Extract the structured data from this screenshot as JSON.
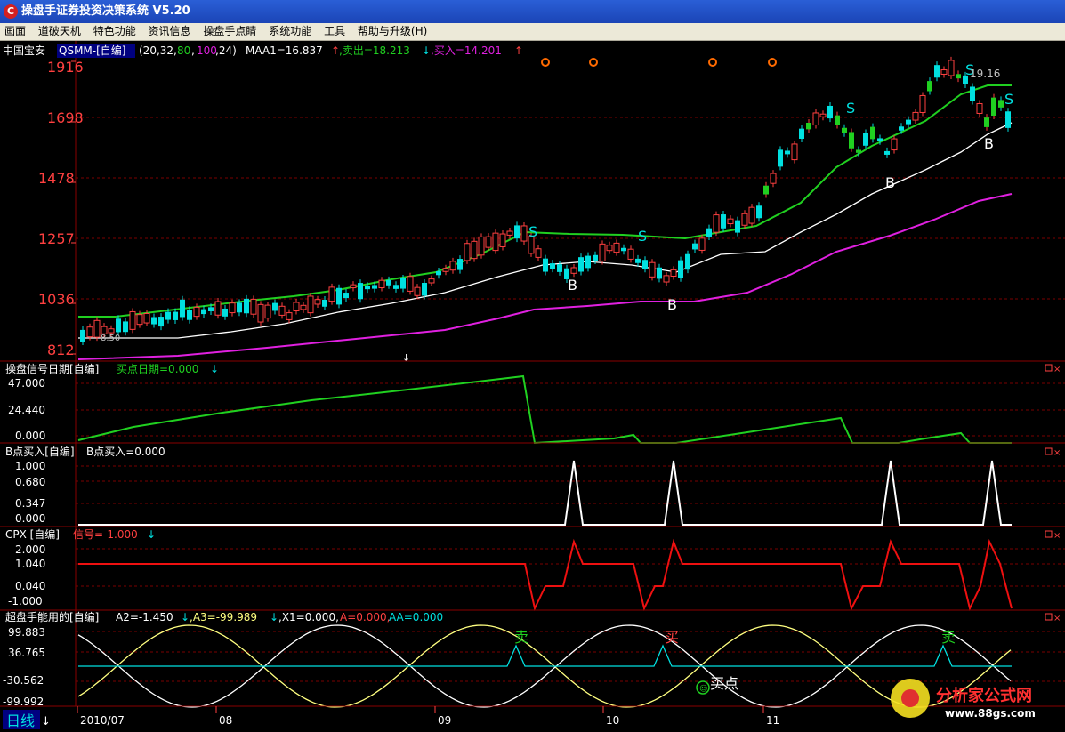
{
  "window": {
    "title": "操盘手证券投资决策系统 V5.20",
    "logo": "C"
  },
  "menu": [
    "画面",
    "道破天机",
    "特色功能",
    "资讯信息",
    "操盘手点睛",
    "系统功能",
    "工具",
    "帮助与升级(H)"
  ],
  "main_panel": {
    "stock": "中国宝安",
    "indicator": "QSMM-[自编]",
    "params_open": "(20,32,",
    "param_80": "80",
    "param_sep": ",",
    "param_100": "100",
    "param_close": ",24)",
    "maa1": "MAA1=16.837",
    "sell": ",卖出=18.213",
    "buy": ",买入=14.201",
    "y_labels": [
      "1916",
      "1698",
      "1478",
      "1257",
      "1036",
      "812"
    ],
    "peak_label": "19.16",
    "bottom_label": "8.50"
  },
  "panel2": {
    "title": "操盘信号日期[自编]",
    "value": "买点日期=0.000",
    "y_labels": [
      "47.000",
      "24.440",
      "0.000"
    ]
  },
  "panel3": {
    "title": "B点买入[自编]",
    "value": "B点买入=0.000",
    "y_labels": [
      "1.000",
      "0.680",
      "0.347",
      "0.000"
    ]
  },
  "panel4": {
    "title": "CPX-[自编]",
    "value": "信号=-1.000",
    "y_labels": [
      "2.000",
      "1.040",
      "0.040",
      "-1.000"
    ]
  },
  "panel5": {
    "title": "超盘手能用的[自编]",
    "a2": "A2=-1.450",
    "a3": ",A3=-99.989",
    "x1": ",X1=0.000,",
    "a": "A=0.000,",
    "aa": "AA=0.000",
    "y_labels": [
      "99.883",
      "36.765",
      "-30.562",
      "-99.992"
    ],
    "marker_labels": [
      "卖",
      "买",
      "卖"
    ],
    "buy_point": "买点"
  },
  "x_axis": {
    "period": "日线",
    "dates": [
      "2010/07",
      "08",
      "09",
      "10",
      "11"
    ]
  },
  "signals": {
    "sell": "S",
    "buy": "B"
  },
  "watermark": {
    "brand": "分析家公式网",
    "url": "www.88gs.com"
  },
  "colors": {
    "up": "#ff4040",
    "down": "#00e0e0",
    "green_line": "#20d020",
    "mid_line": "#ffffff",
    "low_line": "#e020e0",
    "grid": "#8a0000"
  }
}
